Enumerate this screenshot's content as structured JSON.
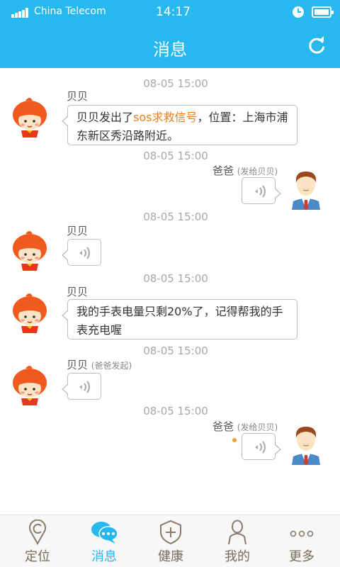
{
  "status_bar": {
    "carrier": "China Telecom",
    "time": "14:17",
    "icons": [
      "signal-icon",
      "alarm-icon",
      "battery-icon"
    ]
  },
  "header": {
    "title": "消息",
    "refresh_icon": "refresh-icon"
  },
  "messages": [
    {
      "timestamp": "08-05  15:00",
      "side": "left",
      "sender": "贝贝",
      "note": "",
      "type": "text",
      "text_before": "贝贝发出了",
      "highlight": "sos求救信号",
      "text_after": "，位置：上海市浦东新区秀沿路附近。"
    },
    {
      "timestamp": "08-05  15:00",
      "side": "right",
      "sender": "爸爸",
      "note": "(发给贝贝)",
      "type": "voice"
    },
    {
      "timestamp": "08-05  15:00",
      "side": "left",
      "sender": "贝贝",
      "note": "",
      "type": "voice"
    },
    {
      "timestamp": "08-05  15:00",
      "side": "left",
      "sender": "贝贝",
      "note": "",
      "type": "text",
      "text": "我的手表电量只剩20%了，记得帮我的手表充电喔"
    },
    {
      "timestamp": "08-05  15:00",
      "side": "left",
      "sender": "贝贝",
      "note": "(爸爸发起)",
      "type": "voice"
    },
    {
      "timestamp": "08-05  15:00",
      "side": "right",
      "sender": "爸爸",
      "note": "(发给贝贝)",
      "type": "voice",
      "unread": true
    }
  ],
  "tabbar": {
    "tabs": [
      {
        "label": "定位",
        "icon": "location-icon",
        "active": false
      },
      {
        "label": "消息",
        "icon": "chat-bubble-icon",
        "active": true
      },
      {
        "label": "健康",
        "icon": "health-shield-icon",
        "active": false
      },
      {
        "label": "我的",
        "icon": "person-icon",
        "active": false
      },
      {
        "label": "更多",
        "icon": "more-dots-icon",
        "active": false
      }
    ]
  },
  "colors": {
    "brand": "#26b8ee",
    "highlight": "#f07d1a",
    "timestamp": "#a8a8a8",
    "tab_inactive": "#7a6a5a",
    "unread_dot": "#f0a030"
  }
}
